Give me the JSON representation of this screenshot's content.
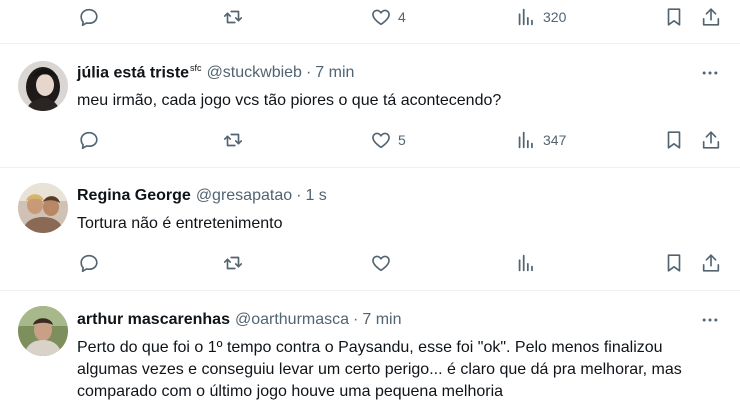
{
  "colors": {
    "text": "#0f1419",
    "muted": "#536471",
    "divider": "#eff3f4"
  },
  "top_actions": {
    "likes": "4",
    "views": "320"
  },
  "tweets": [
    {
      "name": "júlia está triste",
      "name_sup": "sfc",
      "handle": "@stuckwbieb",
      "separator": "·",
      "time": "7 min",
      "text": "meu irmão, cada jogo vcs tão piores o que tá acontecendo?",
      "likes": "5",
      "views": "347"
    },
    {
      "name": "Regina George",
      "handle": "@gresapatao",
      "separator": "·",
      "time": "1 s",
      "text": "Tortura não é entretenimento",
      "likes": "",
      "views": ""
    },
    {
      "name": "arthur mascarenhas",
      "handle": "@oarthurmasca",
      "separator": "·",
      "time": "7 min",
      "text": "Perto do que foi o 1º tempo contra o Paysandu, esse foi \"ok\". Pelo menos finalizou algumas vezes e conseguiu levar um certo perigo... é claro que dá pra melhorar, mas comparado com o último jogo houve uma pequena melhoria"
    }
  ],
  "icons": [
    "reply-icon",
    "retweet-icon",
    "like-icon",
    "views-icon",
    "bookmark-icon",
    "share-icon",
    "more-icon"
  ]
}
